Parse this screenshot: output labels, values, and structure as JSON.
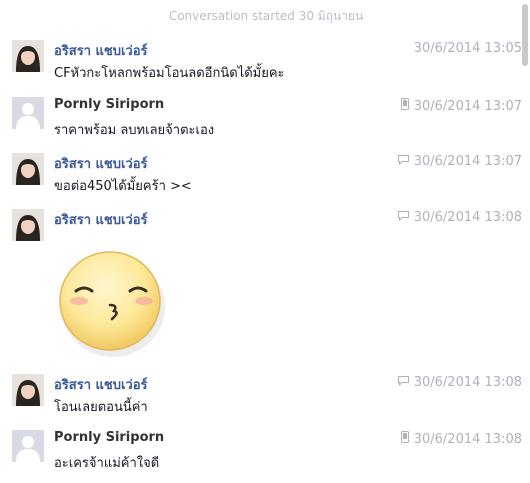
{
  "conversation": {
    "started_label": "Conversation started 30 มิถุนายน"
  },
  "messages": [
    {
      "sender": "อริสรา แชบเว่อร์",
      "time": "30/6/2014 13:05",
      "text": "CFหัวกะโหลกพร้อมโอนลดอีกนิดได้มั้ยคะ",
      "source_icon": "none"
    },
    {
      "sender": "Pornly Siriporn",
      "time": "30/6/2014 13:07",
      "text": "ราคาพร้อม ลบทเลยจ้าตะเอง",
      "source_icon": "mobile-icon"
    },
    {
      "sender": "อริสรา แชบเว่อร์",
      "time": "30/6/2014 13:07",
      "text": "ขอต่อ450ได้มั้ยคร้า ><",
      "source_icon": "chat-icon"
    },
    {
      "sender": "อริสรา แชบเว่อร์",
      "time": "30/6/2014 13:08",
      "text": "",
      "source_icon": "chat-icon",
      "sticker": "kiss-face-sticker"
    },
    {
      "sender": "อริสรา แชบเว่อร์",
      "time": "30/6/2014 13:08",
      "text": "โอนเลยตอนนี้ค่า",
      "source_icon": "chat-icon"
    },
    {
      "sender": "Pornly Siriporn",
      "time": "30/6/2014 13:08",
      "text": "อะเครจ้าแม่ค้าใจดี",
      "source_icon": "mobile-icon"
    }
  ],
  "colors": {
    "female_name": "#3b5998",
    "male_name": "#333333",
    "meta": "#adb2bb"
  }
}
